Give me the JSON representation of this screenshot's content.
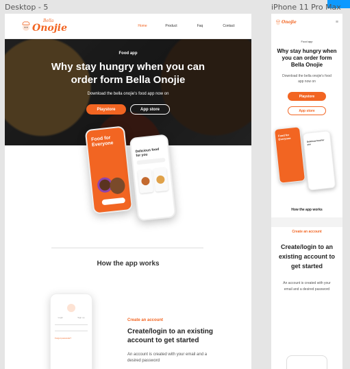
{
  "frames": {
    "desktop_label": "Desktop - 5",
    "phone_label": "iPhone 11 Pro Max"
  },
  "brand": {
    "logo_small": "Bella",
    "logo_big": "Onojie",
    "accent": "#f26522"
  },
  "nav": [
    {
      "label": "Home",
      "active": true
    },
    {
      "label": "Product",
      "active": false
    },
    {
      "label": "Faq",
      "active": false
    },
    {
      "label": "Contact",
      "active": false
    }
  ],
  "hero": {
    "eyebrow": "Food app",
    "title": "Why stay hungry when you can order form Bella Onojie",
    "subtitle": "Download the bella onojie's food app now on",
    "primary_button": "Playstore",
    "secondary_button": "App store"
  },
  "phone_mockups": {
    "left_screen_text": "Food for Everyone",
    "right_screen_text": "Delicious food for you"
  },
  "how_section": {
    "title": "How the app works"
  },
  "step": {
    "eyebrow": "Create an account",
    "title": "Create/login to an existing account to get started",
    "description": "An account is created with your email and a desired password",
    "mockup_tab_login": "Login",
    "mockup_tab_signup": "Sign up",
    "mockup_forgot": "Forgot passcode?"
  },
  "mobile": {
    "eyebrow": "Food app",
    "title": "Why stay hungry when you can order form Bella Onojie",
    "subtitle": "Download the bella onojie's food app now on",
    "primary_button": "Playstore",
    "secondary_button": "App store",
    "section_title": "How the app works",
    "step_eyebrow": "Create an account",
    "step_title": "Create/login to an existing account to get started",
    "step_description": "An account is created with your email and a desired password"
  }
}
